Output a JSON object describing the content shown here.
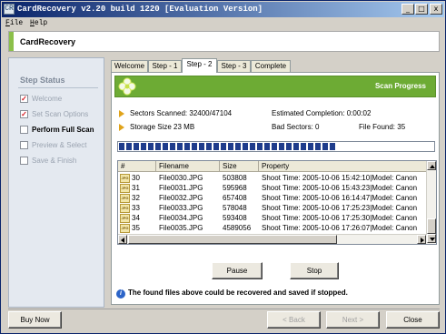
{
  "window": {
    "title": "CardRecovery v2.20 build 1220 [Evaluation Version]",
    "app_icon": "CR",
    "controls": {
      "minimize": "_",
      "maximize": "□",
      "close": "x"
    }
  },
  "menu": [
    {
      "key": "F",
      "rest": "ile"
    },
    {
      "key": "H",
      "rest": "elp"
    }
  ],
  "banner": {
    "title": "CardRecovery"
  },
  "sidebar": {
    "heading": "Step Status",
    "steps": [
      {
        "label": "Welcome",
        "mark": "✓"
      },
      {
        "label": "Set Scan Options",
        "mark": "✓"
      },
      {
        "label": "Perform Full Scan",
        "mark": ""
      },
      {
        "label": "Preview & Select",
        "mark": ""
      },
      {
        "label": "Save & Finish",
        "mark": ""
      }
    ]
  },
  "tabs": [
    "Welcome",
    "Step - 1",
    "Step - 2",
    "Step - 3",
    "Complete"
  ],
  "active_tab": "Step - 2",
  "panel": {
    "title": "Scan Progress",
    "stats": {
      "sectors_scanned": "Sectors Scanned: 32400/47104",
      "estimated_completion": "Estimated Completion: 0:00:02",
      "storage_size": "Storage Size 23 MB",
      "bad_sectors": "Bad Sectors: 0",
      "file_found": "File Found: 35"
    },
    "progress": 0.69,
    "list": {
      "columns": [
        "#",
        "Filename",
        "Size",
        "Property"
      ],
      "rows": [
        {
          "num": "30",
          "filename": "File0030.JPG",
          "size": "503808",
          "property": "Shoot Time: 2005-10-06 15:42:10|Model: Canon"
        },
        {
          "num": "31",
          "filename": "File0031.JPG",
          "size": "595968",
          "property": "Shoot Time: 2005-10-06 15:43:23|Model: Canon"
        },
        {
          "num": "32",
          "filename": "File0032.JPG",
          "size": "657408",
          "property": "Shoot Time: 2005-10-06 16:14:47|Model: Canon"
        },
        {
          "num": "33",
          "filename": "File0033.JPG",
          "size": "578048",
          "property": "Shoot Time: 2005-10-06 17:25:23|Model: Canon"
        },
        {
          "num": "34",
          "filename": "File0034.JPG",
          "size": "593408",
          "property": "Shoot Time: 2005-10-06 17:25:30|Model: Canon"
        },
        {
          "num": "35",
          "filename": "File0035.JPG",
          "size": "4589056",
          "property": "Shoot Time: 2005-10-06 17:26:07|Model: Canon"
        }
      ],
      "file_icon": "JPG"
    },
    "pause_label": "Pause",
    "stop_label": "Stop",
    "info_icon": "i",
    "info_text": "The found files above could be recovered and saved if stopped."
  },
  "footer": {
    "buy_now": "Buy Now",
    "back": "< Back",
    "next": "Next >",
    "close": "Close"
  },
  "colors": {
    "banner_accent": "#8cc04a",
    "panel_header": "#6dab34",
    "progress": "#1e3c8c",
    "check": "#d4171f"
  }
}
